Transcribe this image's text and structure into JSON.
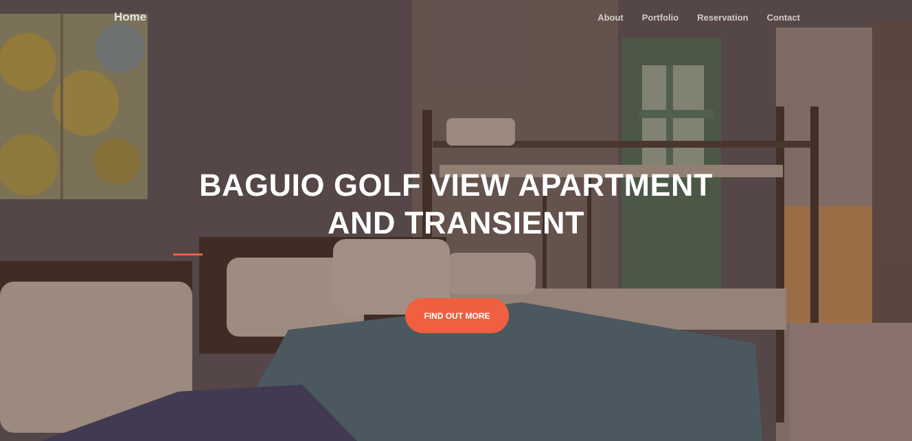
{
  "navbar": {
    "brand": "Home",
    "links": [
      "About",
      "Portfolio",
      "Reservation",
      "Contact"
    ]
  },
  "hero": {
    "headline_line1": "BAGUIO GOLF VIEW APARTMENT",
    "headline_line2": "AND TRANSIENT",
    "cta_label": "FIND OUT MORE"
  },
  "colors": {
    "accent": "#f05f40",
    "overlay": "#5c3a2c"
  }
}
